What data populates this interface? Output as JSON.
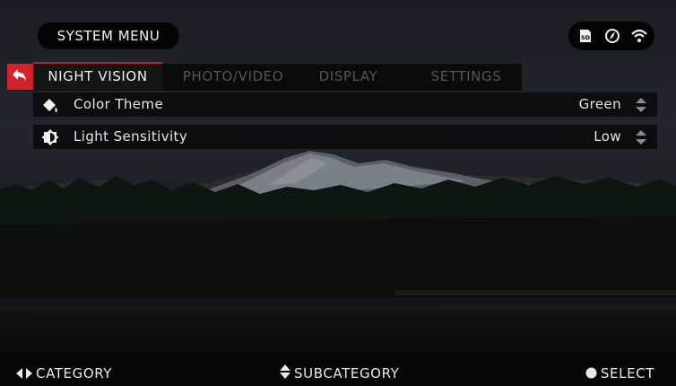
{
  "header": {
    "title": "SYSTEM MENU",
    "status_icons": [
      "sd-card-icon",
      "compass-icon",
      "wifi-icon"
    ],
    "sd_label": "SD"
  },
  "tabs": [
    {
      "label": "NIGHT VISION",
      "active": true
    },
    {
      "label": "PHOTO/VIDEO",
      "active": false
    },
    {
      "label": "DISPLAY",
      "active": false
    },
    {
      "label": "SETTINGS",
      "active": false
    }
  ],
  "menu": {
    "items": [
      {
        "label": "Color Theme",
        "value": "Green",
        "icon": "paint-bucket-icon"
      },
      {
        "label": "Light Sensitivity",
        "value": "Low",
        "icon": "brightness-icon"
      }
    ]
  },
  "footer": {
    "category": "CATEGORY",
    "subcategory": "SUBCATEGORY",
    "select": "SELECT"
  },
  "colors": {
    "accent": "#d2222a",
    "tab_active_bg": "#151516",
    "tab_inactive_text": "#555555",
    "row_bg": "#0c0c0d",
    "text": "#e6e6e6"
  }
}
